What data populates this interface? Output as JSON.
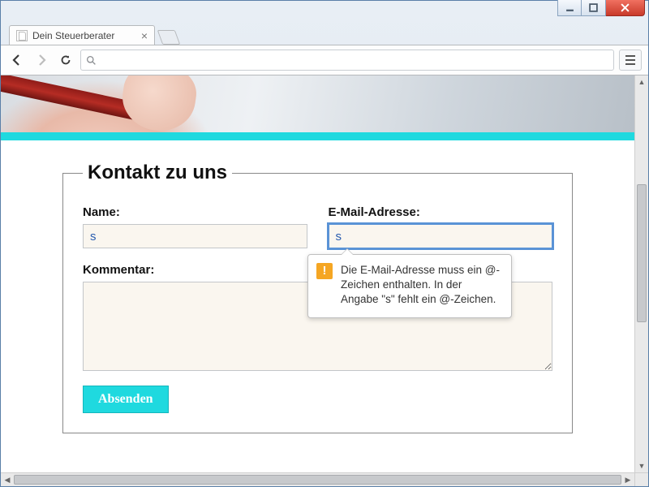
{
  "window": {
    "title": ""
  },
  "tab": {
    "title": "Dein Steuerberater"
  },
  "omnibox": {
    "value": ""
  },
  "hero": {
    "accent_color": "#1fd9df"
  },
  "form": {
    "legend": "Kontakt zu uns",
    "name": {
      "label": "Name:",
      "value": "s"
    },
    "email": {
      "label": "E-Mail-Adresse:",
      "value": "s"
    },
    "comment": {
      "label": "Kommentar:",
      "value": ""
    },
    "submit_label": "Absenden"
  },
  "validation": {
    "message": "Die E-Mail-Adresse muss ein @-Zeichen enthalten. In der Angabe \"s\" fehlt ein @-Zeichen."
  }
}
